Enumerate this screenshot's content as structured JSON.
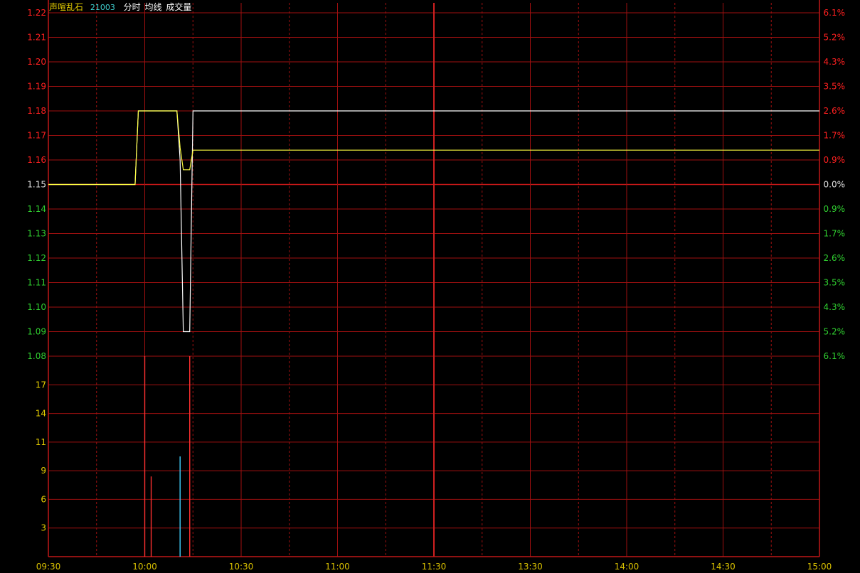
{
  "header": {
    "stock_name": "声喧乱石",
    "stock_code": "21003",
    "label_intraday": "分时",
    "label_avg": "均线",
    "label_volume": "成交量"
  },
  "colors": {
    "background": "#000000",
    "grid": "#a01010",
    "axis": "#c01818",
    "up_text": "#ff2020",
    "down_text": "#30d030",
    "flat_text": "#e0e0e0",
    "volume_tick_text": "#e8d000",
    "time_text": "#d8c000",
    "price_line": "#ffffff",
    "avg_line": "#ffff40",
    "volume_up": "#ff3030",
    "volume_down": "#40d0ff",
    "stock_name": "#e8d000",
    "stock_code": "#40d0d0",
    "label_text": "#ffffff"
  },
  "chart_data": [
    {
      "type": "line",
      "panel": "price",
      "prev_close": 1.15,
      "ylim": [
        1.08,
        1.22
      ],
      "y_ticks": [
        "1.22",
        "1.21",
        "1.20",
        "1.19",
        "1.18",
        "1.17",
        "1.16",
        "1.15",
        "1.14",
        "1.13",
        "1.12",
        "1.11",
        "1.10",
        "1.09",
        "1.08"
      ],
      "pct_ticks": [
        "6.1%",
        "5.2%",
        "4.3%",
        "3.5%",
        "2.6%",
        "1.7%",
        "0.9%",
        "0.0%",
        "0.9%",
        "1.7%",
        "2.6%",
        "3.5%",
        "4.3%",
        "5.2%",
        "6.1%"
      ],
      "x_ticks": [
        "09:30",
        "10:00",
        "10:30",
        "11:00",
        "11:30",
        "13:30",
        "14:00",
        "14:30",
        "15:00"
      ],
      "series": [
        {
          "role": "price",
          "points": [
            [
              "09:30",
              1.15
            ],
            [
              "09:57",
              1.15
            ],
            [
              "09:58",
              1.18
            ],
            [
              "10:00",
              1.18
            ],
            [
              "10:10",
              1.18
            ],
            [
              "10:11",
              1.16
            ],
            [
              "10:12",
              1.09
            ],
            [
              "10:14",
              1.09
            ],
            [
              "10:15",
              1.18
            ],
            [
              "15:00",
              1.18
            ]
          ]
        },
        {
          "role": "average",
          "points": [
            [
              "09:30",
              1.15
            ],
            [
              "09:57",
              1.15
            ],
            [
              "09:58",
              1.18
            ],
            [
              "10:00",
              1.18
            ],
            [
              "10:10",
              1.18
            ],
            [
              "10:11",
              1.165
            ],
            [
              "10:12",
              1.156
            ],
            [
              "10:14",
              1.156
            ],
            [
              "10:15",
              1.164
            ],
            [
              "15:00",
              1.164
            ]
          ]
        }
      ]
    },
    {
      "type": "bar",
      "panel": "volume",
      "ylim": [
        0,
        20
      ],
      "y_ticks": [
        "17",
        "14",
        "11",
        "9",
        "6",
        "3"
      ],
      "bars": [
        {
          "time": "10:00",
          "value": 20,
          "dir": "up"
        },
        {
          "time": "10:02",
          "value": 8,
          "dir": "up"
        },
        {
          "time": "10:11",
          "value": 10,
          "dir": "down"
        },
        {
          "time": "10:14",
          "value": 20,
          "dir": "up"
        }
      ]
    }
  ]
}
